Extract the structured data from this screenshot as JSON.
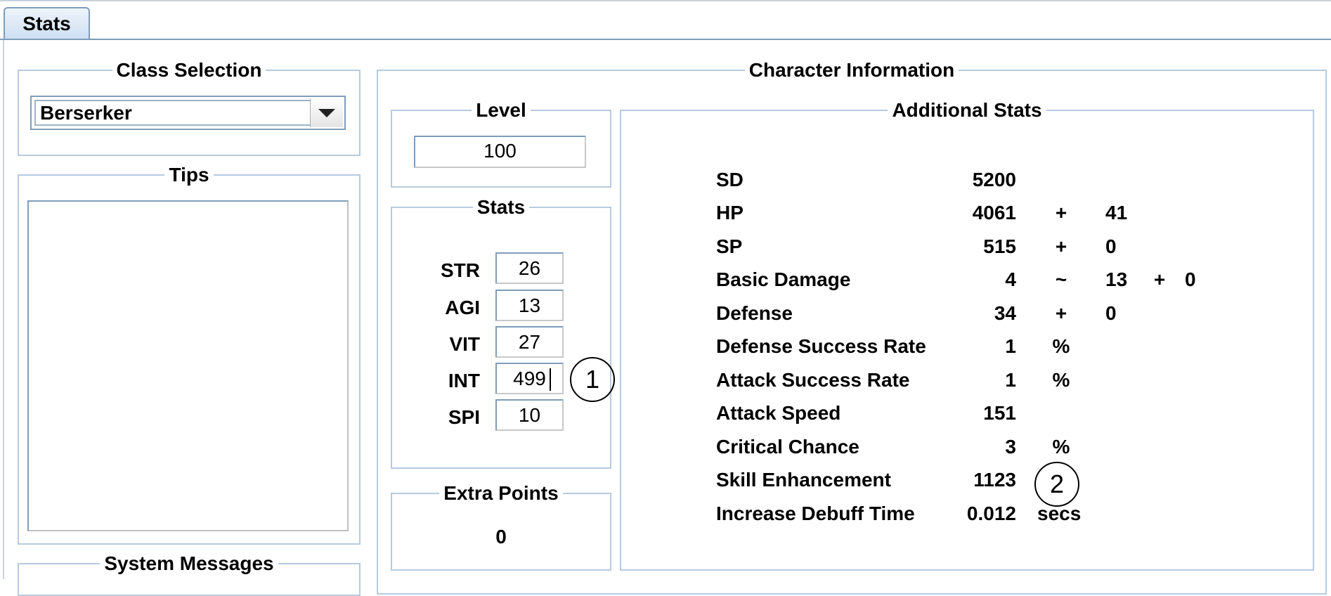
{
  "tab": {
    "label": "Stats"
  },
  "class_selection": {
    "legend": "Class Selection",
    "selected": "Berserker"
  },
  "tips": {
    "legend": "Tips",
    "content": ""
  },
  "system_messages": {
    "legend": "System Messages"
  },
  "character_information": {
    "legend": "Character Information"
  },
  "level": {
    "legend": "Level",
    "value": "100"
  },
  "stats": {
    "legend": "Stats",
    "rows": [
      {
        "label": "STR",
        "value": "26"
      },
      {
        "label": "AGI",
        "value": "13"
      },
      {
        "label": "VIT",
        "value": "27"
      },
      {
        "label": "INT",
        "value": "499"
      },
      {
        "label": "SPI",
        "value": "10"
      }
    ]
  },
  "extra_points": {
    "legend": "Extra Points",
    "value": "0"
  },
  "additional_stats": {
    "legend": "Additional Stats",
    "rows": [
      {
        "name": "SD",
        "value": "5200"
      },
      {
        "name": "HP",
        "value": "4061",
        "op": "+",
        "value2": "41"
      },
      {
        "name": "SP",
        "value": "515",
        "op": "+",
        "value2": "0"
      },
      {
        "name": "Basic Damage",
        "value": "4",
        "op": "~",
        "value2": "13",
        "op2": "+",
        "value3": "0"
      },
      {
        "name": "Defense",
        "value": "34",
        "op": "+",
        "value2": "0"
      },
      {
        "name": "Defense Success Rate",
        "value": "1",
        "unit": "%"
      },
      {
        "name": "Attack Success Rate",
        "value": "1",
        "unit": "%"
      },
      {
        "name": "Attack Speed",
        "value": "151"
      },
      {
        "name": "Critical Chance",
        "value": "3",
        "unit": "%"
      },
      {
        "name": "Skill Enhancement",
        "value": "1123"
      },
      {
        "name": "Increase Debuff Time",
        "value": "0.012",
        "unit": "secs"
      }
    ]
  },
  "annotations": {
    "marker1": "1",
    "marker2": "2"
  }
}
